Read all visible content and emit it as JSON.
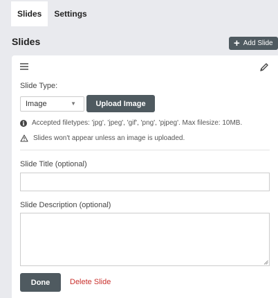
{
  "tabs": [
    {
      "label": "Slides",
      "active": true
    },
    {
      "label": "Settings",
      "active": false
    }
  ],
  "section": {
    "title": "Slides",
    "add_button_label": "Add Slide"
  },
  "slide_card": {
    "slide_type_label": "Slide Type:",
    "slide_type_value": "Image",
    "upload_button_label": "Upload Image",
    "accepted_filetypes_note": "Accepted filetypes: 'jpg', 'jpeg', 'gif', 'png', 'pjpeg'. Max filesize: 10MB.",
    "warning_note": "Slides won't appear unless an image is uploaded.",
    "title_label": "Slide Title (optional)",
    "title_value": "",
    "description_label": "Slide Description (optional)",
    "description_value": "",
    "done_button_label": "Done",
    "delete_link_label": "Delete Slide"
  },
  "icons": {
    "drag_handle": "drag-handle-icon",
    "edit": "pencil-icon",
    "add": "plus-icon",
    "info": "info-icon",
    "warning": "warning-icon",
    "dropdown": "chevron-down-icon"
  },
  "colors": {
    "button_bg": "#4f5a60",
    "page_bg": "#e9eaee",
    "danger": "#c9302c"
  }
}
